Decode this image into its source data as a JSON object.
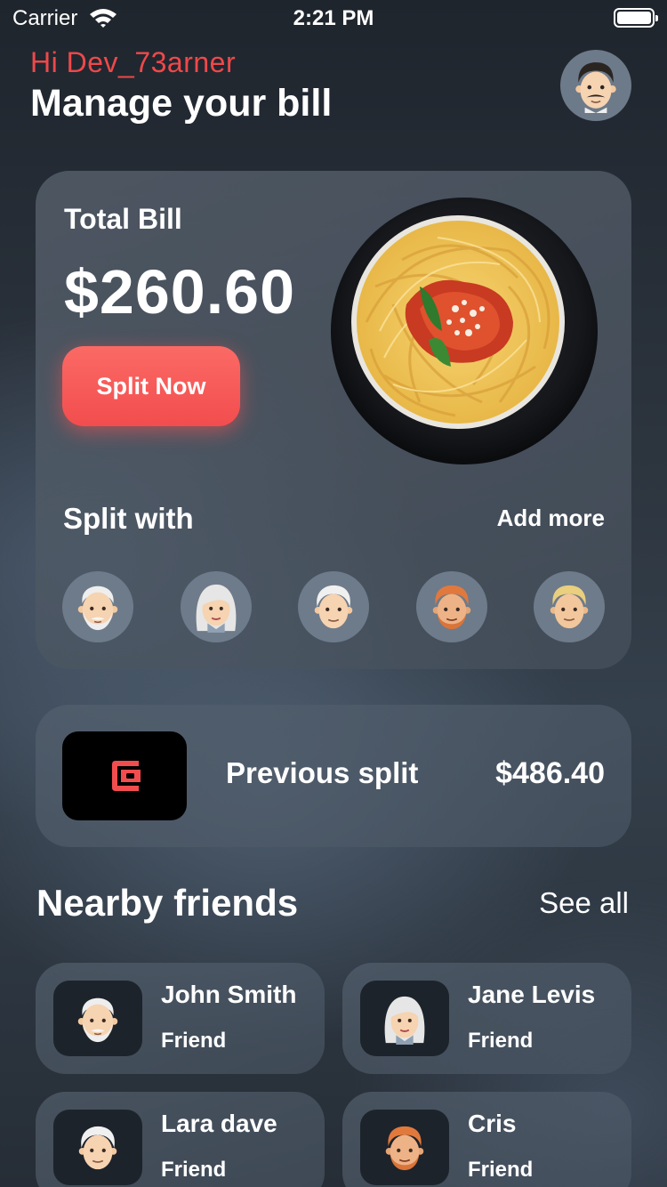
{
  "status_bar": {
    "carrier": "Carrier",
    "time": "2:21 PM"
  },
  "header": {
    "greeting": "Hi Dev_73arner",
    "title": "Manage your bill",
    "profile_avatar": "man-avatar-icon"
  },
  "bill": {
    "total_label": "Total Bill",
    "total_amount": "$260.60",
    "split_button": "Split Now",
    "image": "spaghetti-plate-image",
    "split_with_label": "Split with",
    "add_more": "Add more",
    "split_avatars": [
      "old-man-avatar",
      "old-woman-avatar",
      "old-person-avatar",
      "redhead-man-avatar",
      "blond-person-avatar"
    ]
  },
  "previous_split": {
    "icon": "wallet-icon",
    "label": "Previous split",
    "amount": "$486.40"
  },
  "nearby": {
    "title": "Nearby friends",
    "see_all": "See all",
    "friends": [
      {
        "name": "John Smith",
        "role": "Friend",
        "avatar": "old-man-avatar"
      },
      {
        "name": "Jane Levis",
        "role": "Friend",
        "avatar": "old-woman-avatar"
      },
      {
        "name": "Lara dave",
        "role": "Friend",
        "avatar": "old-person-avatar"
      },
      {
        "name": "Cris",
        "role": "Friend",
        "avatar": "redhead-man-avatar"
      }
    ]
  },
  "colors": {
    "accent": "#f24d4e",
    "greeting": "#f0484a",
    "background": "#2d353f"
  }
}
